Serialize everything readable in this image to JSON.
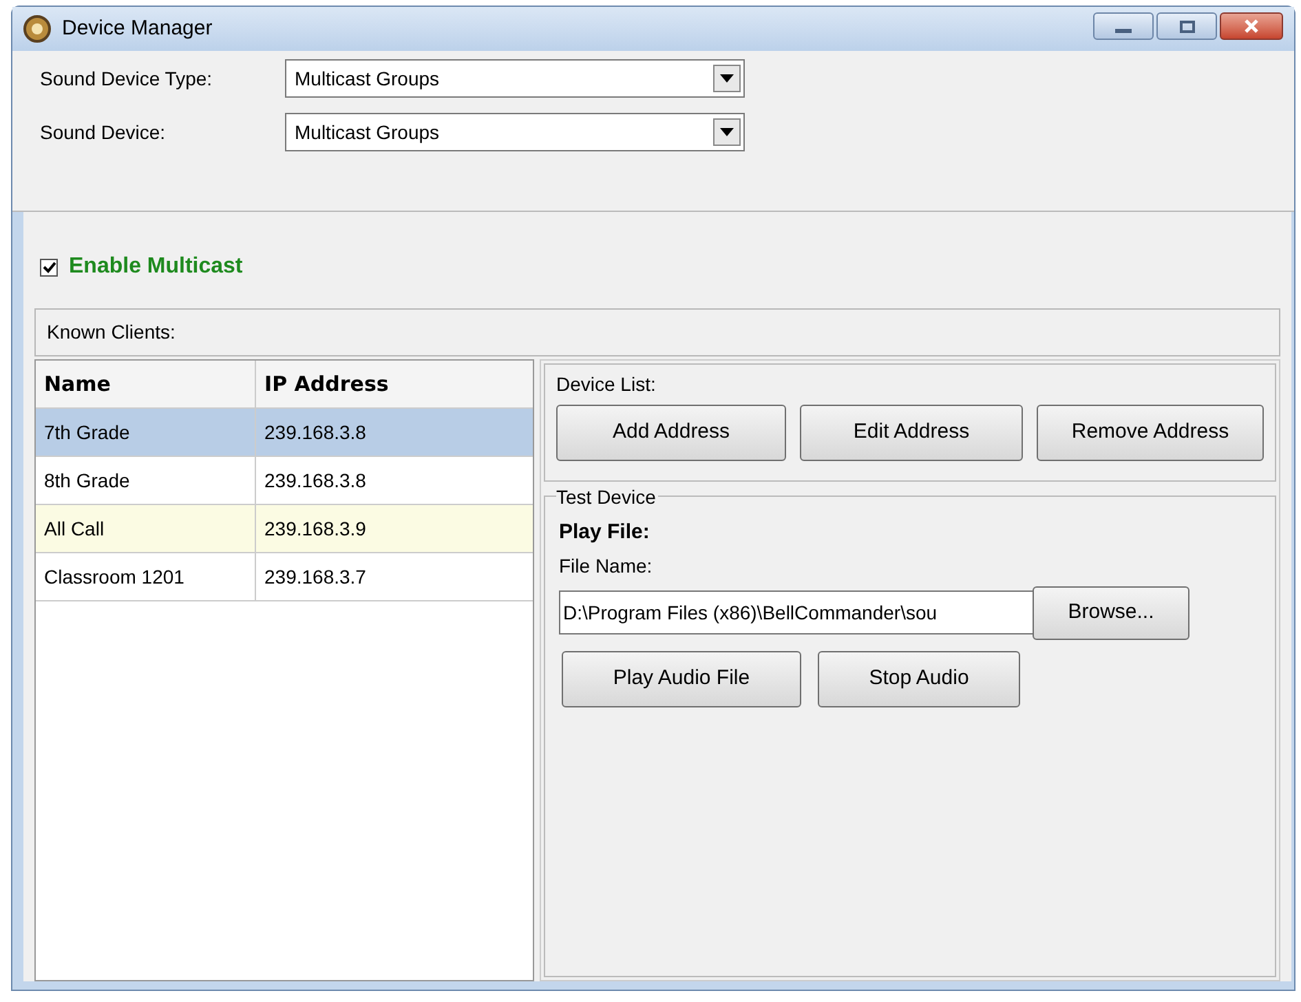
{
  "window": {
    "title": "Device Manager"
  },
  "fields": [
    {
      "label": "Sound Device Type:",
      "value": "Multicast Groups"
    },
    {
      "label": "Sound Device:",
      "value": "Multicast Groups"
    }
  ],
  "enable_multicast": {
    "label": "Enable Multicast",
    "checked": true
  },
  "known_clients": {
    "title": "Known Clients:",
    "columns": [
      "Name",
      "IP Address"
    ],
    "rows": [
      {
        "cells": [
          "7th Grade",
          "239.168.3.8"
        ],
        "selected": true,
        "hovered": false
      },
      {
        "cells": [
          "8th Grade",
          "239.168.3.8"
        ],
        "selected": false,
        "hovered": false
      },
      {
        "cells": [
          "All Call",
          "239.168.3.9"
        ],
        "selected": false,
        "hovered": true
      },
      {
        "cells": [
          "Classroom 1201",
          "239.168.3.7"
        ],
        "selected": false,
        "hovered": false
      }
    ]
  },
  "device_list": {
    "title": "Device List:",
    "buttons": [
      "Add Address",
      "Edit Address",
      "Remove Address"
    ]
  },
  "test_device": {
    "title": "Test Device",
    "heading": "Play File:",
    "file_label": "File Name:",
    "file_value": "D:\\Program Files (x86)\\BellCommander\\sou",
    "browse": "Browse...",
    "buttons": [
      "Play Audio File",
      "Stop Audio"
    ]
  }
}
